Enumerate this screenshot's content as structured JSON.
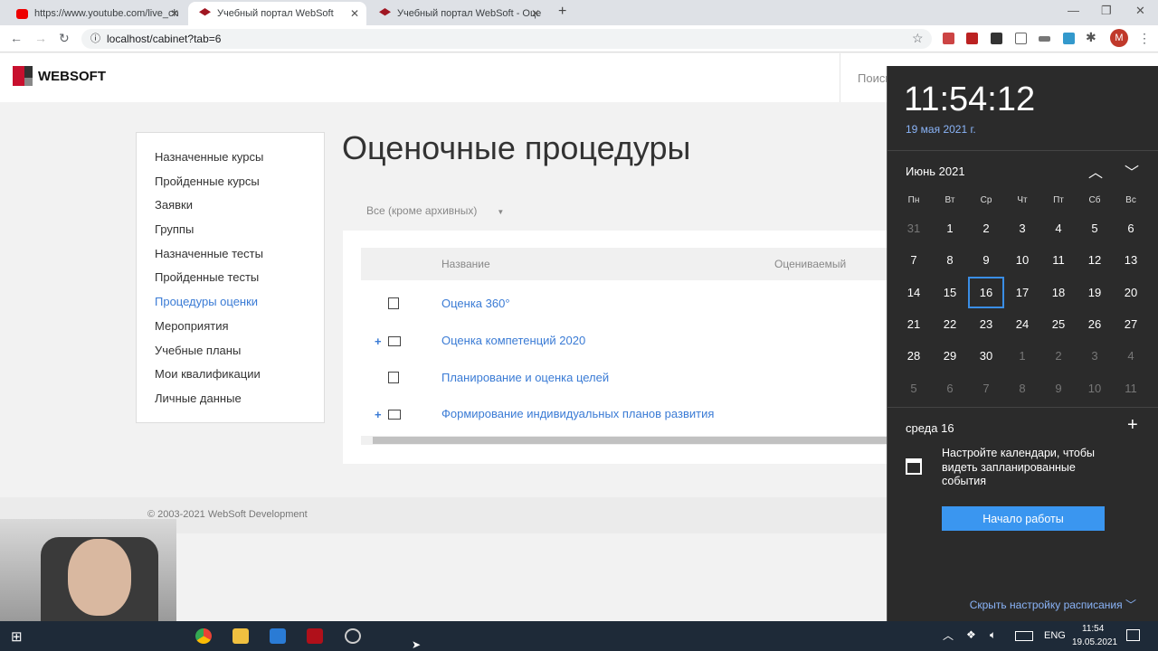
{
  "browser": {
    "tabs": [
      {
        "title": "https://www.youtube.com/live_ch"
      },
      {
        "title": "Учебный портал WebSoft"
      },
      {
        "title": "Учебный портал WebSoft - Оце"
      }
    ],
    "url": "localhost/cabinet?tab=6",
    "profile_initial": "M"
  },
  "header": {
    "logo": "WEBSOFT",
    "search": "Поиск"
  },
  "sidebar": {
    "items": [
      {
        "label": "Назначенные курсы"
      },
      {
        "label": "Пройденные курсы"
      },
      {
        "label": "Заявки"
      },
      {
        "label": "Группы"
      },
      {
        "label": "Назначенные тесты"
      },
      {
        "label": "Пройденные тесты"
      },
      {
        "label": "Процедуры оценки",
        "active": true
      },
      {
        "label": "Мероприятия"
      },
      {
        "label": "Учебные планы"
      },
      {
        "label": "Мои квалификации"
      },
      {
        "label": "Личные данные"
      }
    ]
  },
  "main": {
    "title": "Оценочные процедуры",
    "filter": "Все (кроме архивных)",
    "columns": [
      "Название",
      "Оцениваемый"
    ],
    "rows": [
      {
        "name": "Оценка 360°",
        "type": "file"
      },
      {
        "name": "Оценка компетенций 2020",
        "type": "folder"
      },
      {
        "name": "Планирование и оценка целей",
        "type": "file"
      },
      {
        "name": "Формирование индивидуальных планов развития",
        "type": "folder"
      }
    ]
  },
  "footer": {
    "copyright": "© 2003-2021 WebSoft Development"
  },
  "calendar": {
    "time": "11:54:12",
    "date": "19 мая 2021 г.",
    "month": "Июнь 2021",
    "weekdays": [
      "Пн",
      "Вт",
      "Ср",
      "Чт",
      "Пт",
      "Сб",
      "Вс"
    ],
    "weeks": [
      [
        "31",
        "1",
        "2",
        "3",
        "4",
        "5",
        "6"
      ],
      [
        "7",
        "8",
        "9",
        "10",
        "11",
        "12",
        "13"
      ],
      [
        "14",
        "15",
        "16",
        "17",
        "18",
        "19",
        "20"
      ],
      [
        "21",
        "22",
        "23",
        "24",
        "25",
        "26",
        "27"
      ],
      [
        "28",
        "29",
        "30",
        "1",
        "2",
        "3",
        "4"
      ],
      [
        "5",
        "6",
        "7",
        "8",
        "9",
        "10",
        "11"
      ]
    ],
    "selected": "16",
    "agenda_day": "среда 16",
    "agenda_text": "Настройте календари, чтобы видеть запланированные события",
    "start_button": "Начало работы",
    "hide_link": "Скрыть настройку расписания"
  },
  "taskbar": {
    "lang": "ENG",
    "time": "11:54",
    "date": "19.05.2021"
  }
}
